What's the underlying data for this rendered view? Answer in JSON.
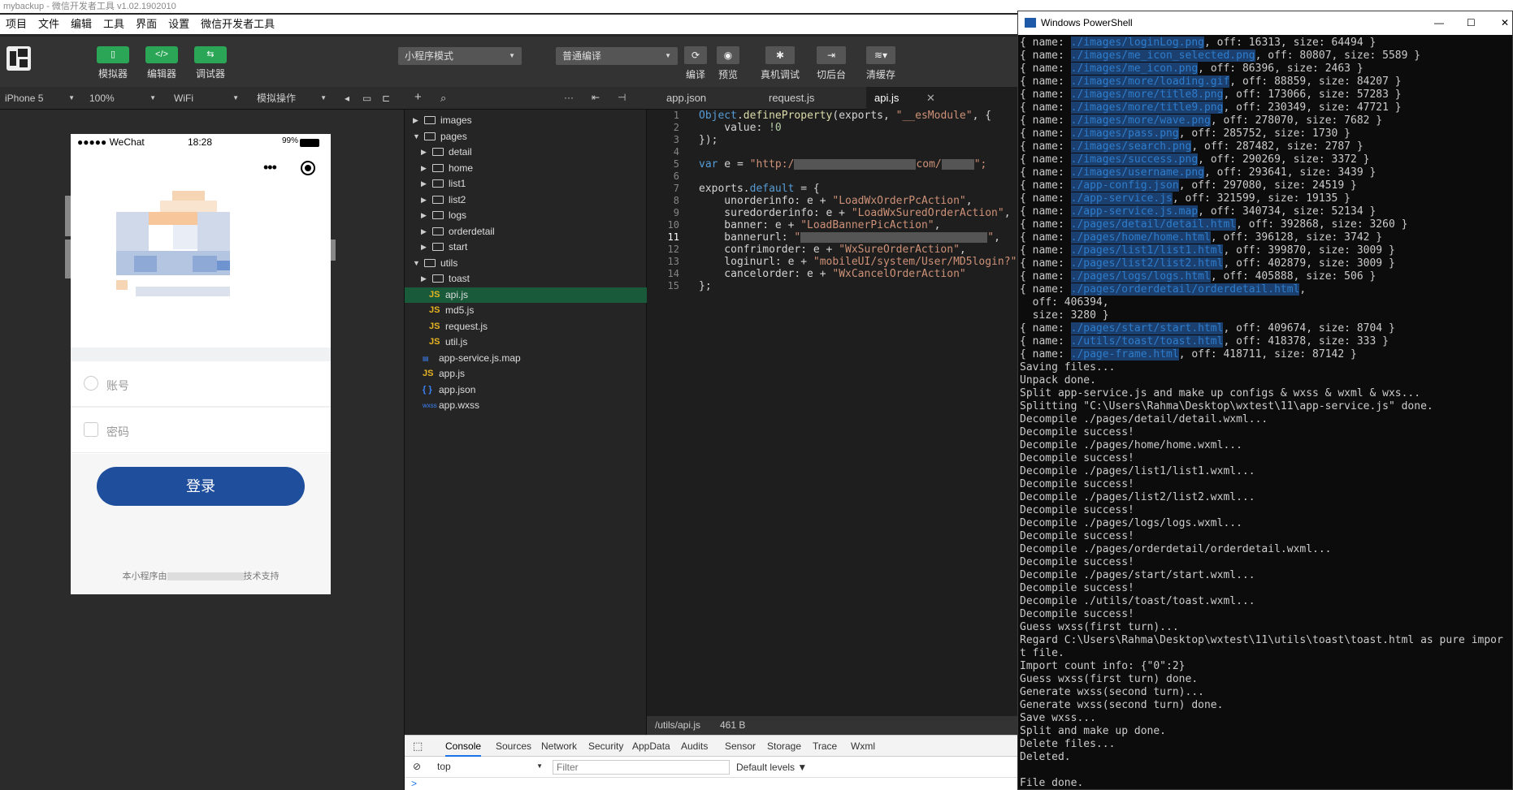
{
  "window": {
    "title": "mybackup - 微信开发者工具 v1.02.1902010"
  },
  "menu": [
    "项目",
    "文件",
    "编辑",
    "工具",
    "界面",
    "设置",
    "微信开发者工具"
  ],
  "toolbar": {
    "simulator": "模拟器",
    "editor": "编辑器",
    "debugger": "调试器",
    "mode": "小程序模式",
    "compile_mode": "普通编译",
    "compile": "编译",
    "preview": "预览",
    "remote_debug": "真机调试",
    "background": "切后台",
    "clear_cache": "清缓存"
  },
  "simulator_bar": {
    "device": "iPhone 5",
    "zoom": "100%",
    "network": "WiFi",
    "operation": "模拟操作"
  },
  "phone": {
    "carrier": "●●●●● WeChat",
    "time": "18:28",
    "battery": "99%",
    "account_placeholder": "账号",
    "password_placeholder": "密码",
    "login_button": "登录",
    "support_prefix": "本小程序由",
    "support_suffix": "技术支持"
  },
  "file_tree": [
    {
      "name": "images",
      "type": "folder",
      "depth": 0,
      "open": false
    },
    {
      "name": "pages",
      "type": "folder",
      "depth": 0,
      "open": true
    },
    {
      "name": "detail",
      "type": "folder",
      "depth": 1,
      "open": false
    },
    {
      "name": "home",
      "type": "folder",
      "depth": 1,
      "open": false
    },
    {
      "name": "list1",
      "type": "folder",
      "depth": 1,
      "open": false
    },
    {
      "name": "list2",
      "type": "folder",
      "depth": 1,
      "open": false
    },
    {
      "name": "logs",
      "type": "folder",
      "depth": 1,
      "open": false
    },
    {
      "name": "orderdetail",
      "type": "folder",
      "depth": 1,
      "open": false
    },
    {
      "name": "start",
      "type": "folder",
      "depth": 1,
      "open": false
    },
    {
      "name": "utils",
      "type": "folder",
      "depth": 0,
      "open": true
    },
    {
      "name": "toast",
      "type": "folder",
      "depth": 1,
      "open": false
    },
    {
      "name": "api.js",
      "type": "js",
      "depth": 1,
      "active": true
    },
    {
      "name": "md5.js",
      "type": "js",
      "depth": 1
    },
    {
      "name": "request.js",
      "type": "js",
      "depth": 1
    },
    {
      "name": "util.js",
      "type": "js",
      "depth": 1
    },
    {
      "name": "app-service.js.map",
      "type": "map",
      "depth": 0
    },
    {
      "name": "app.js",
      "type": "js",
      "depth": 0
    },
    {
      "name": "app.json",
      "type": "json",
      "depth": 0
    },
    {
      "name": "app.wxss",
      "type": "wxss",
      "depth": 0
    }
  ],
  "editor_tabs": [
    {
      "label": "app.json"
    },
    {
      "label": "request.js"
    },
    {
      "label": "api.js",
      "active": true
    }
  ],
  "code": {
    "line_numbers": [
      "1",
      "2",
      "3",
      "4",
      "5",
      "6",
      "7",
      "8",
      "9",
      "10",
      "11",
      "12",
      "13",
      "14",
      "15"
    ],
    "l1_obj": "Object",
    "l1_fn": "defineProperty",
    "l1_args": "(exports, ",
    "l1_str": "\"__esModule\"",
    "l1_end": ", {",
    "l2_key": "    value: ",
    "l2_val": "!0",
    "l3": "});",
    "l5_kw": "var",
    "l5_mid": " e = ",
    "l5_s1": "\"http:/",
    "l5_s2": "com/",
    "l5_s3": "\";",
    "l7_a": "exports.",
    "l7_kw": "default",
    "l7_b": " = {",
    "l8_k": "    unorderinfo: e + ",
    "l8_s": "\"LoadWxOrderPcAction\"",
    "l8_e": ",",
    "l9_k": "    suredorderinfo: e + ",
    "l9_s": "\"LoadWxSuredOrderAction\"",
    "l9_e": ",",
    "l10_k": "    banner: e + ",
    "l10_s": "\"LoadBannerPicAction\"",
    "l10_e": ",",
    "l11_k": "    bannerurl: ",
    "l11_s1": "\"",
    "l11_s2": "\"",
    "l11_e": ",",
    "l12_k": "    confrimorder: e + ",
    "l12_s": "\"WxSureOrderAction\"",
    "l12_e": ",",
    "l13_k": "    loginurl: e + ",
    "l13_s": "\"mobileUI/system/User/MD5login?\"",
    "l13_e": ",",
    "l14_k": "    cancelorder: e + ",
    "l14_s": "\"WxCancelOrderAction\"",
    "l15": "};"
  },
  "editor_status": {
    "path": "/utils/api.js",
    "size": "461 B"
  },
  "devtools": {
    "tabs": [
      "Console",
      "Sources",
      "Network",
      "Security",
      "AppData",
      "Audits",
      "Sensor",
      "Storage",
      "Trace",
      "Wxml"
    ],
    "context": "top",
    "filter_placeholder": "Filter",
    "levels": "Default levels",
    "prompt": ">"
  },
  "powershell": {
    "title": "Windows PowerShell",
    "lines": [
      {
        "pre": "{ name: ",
        "hl": "./images/loginLog.png",
        "post": ", off: 16313, size: 64494 }"
      },
      {
        "pre": "{ name: ",
        "hl": "./images/me_icon_selected.png",
        "post": ", off: 80807, size: 5589 }"
      },
      {
        "pre": "{ name: ",
        "hl": "./images/me_icon.png",
        "post": ", off: 86396, size: 2463 }"
      },
      {
        "pre": "{ name: ",
        "hl": "./images/more/loading.gif",
        "post": ", off: 88859, size: 84207 }"
      },
      {
        "pre": "{ name: ",
        "hl": "./images/more/title8.png",
        "post": ", off: 173066, size: 57283 }"
      },
      {
        "pre": "{ name: ",
        "hl": "./images/more/title9.png",
        "post": ", off: 230349, size: 47721 }"
      },
      {
        "pre": "{ name: ",
        "hl": "./images/more/wave.png",
        "post": ", off: 278070, size: 7682 }"
      },
      {
        "pre": "{ name: ",
        "hl": "./images/pass.png",
        "post": ", off: 285752, size: 1730 }"
      },
      {
        "pre": "{ name: ",
        "hl": "./images/search.png",
        "post": ", off: 287482, size: 2787 }"
      },
      {
        "pre": "{ name: ",
        "hl": "./images/success.png",
        "post": ", off: 290269, size: 3372 }"
      },
      {
        "pre": "{ name: ",
        "hl": "./images/username.png",
        "post": ", off: 293641, size: 3439 }"
      },
      {
        "pre": "{ name: ",
        "hl": "./app-config.json",
        "post": ", off: 297080, size: 24519 }"
      },
      {
        "pre": "{ name: ",
        "hl": "./app-service.js",
        "post": ", off: 321599, size: 19135 }"
      },
      {
        "pre": "{ name: ",
        "hl": "./app-service.js.map",
        "post": ", off: 340734, size: 52134 }"
      },
      {
        "pre": "{ name: ",
        "hl": "./pages/detail/detail.html",
        "post": ", off: 392868, size: 3260 }"
      },
      {
        "pre": "{ name: ",
        "hl": "./pages/home/home.html",
        "post": ", off: 396128, size: 3742 }"
      },
      {
        "pre": "{ name: ",
        "hl": "./pages/list1/list1.html",
        "post": ", off: 399870, size: 3009 }"
      },
      {
        "pre": "{ name: ",
        "hl": "./pages/list2/list2.html",
        "post": ", off: 402879, size: 3009 }"
      },
      {
        "pre": "{ name: ",
        "hl": "./pages/logs/logs.html",
        "post": ", off: 405888, size: 506 }"
      },
      {
        "pre": "{ name: ",
        "hl": "./pages/orderdetail/orderdetail.html",
        "post": ","
      },
      {
        "pre": "  off: 406394,",
        "hl": "",
        "post": ""
      },
      {
        "pre": "  size: 3280 }",
        "hl": "",
        "post": ""
      },
      {
        "pre": "{ name: ",
        "hl": "./pages/start/start.html",
        "post": ", off: 409674, size: 8704 }"
      },
      {
        "pre": "{ name: ",
        "hl": "./utils/toast/toast.html",
        "post": ", off: 418378, size: 333 }"
      },
      {
        "pre": "{ name: ",
        "hl": "./page-frame.html",
        "post": ", off: 418711, size: 87142 }"
      },
      {
        "pre": "Saving files...",
        "hl": "",
        "post": ""
      },
      {
        "pre": "Unpack done.",
        "hl": "",
        "post": ""
      },
      {
        "pre": "Split app-service.js and make up configs & wxss & wxml & wxs...",
        "hl": "",
        "post": ""
      },
      {
        "pre": "Splitting \"C:\\Users\\Rahma\\Desktop\\wxtest\\11\\app-service.js\" done.",
        "hl": "",
        "post": ""
      },
      {
        "pre": "Decompile ./pages/detail/detail.wxml...",
        "hl": "",
        "post": ""
      },
      {
        "pre": "Decompile success!",
        "hl": "",
        "post": ""
      },
      {
        "pre": "Decompile ./pages/home/home.wxml...",
        "hl": "",
        "post": ""
      },
      {
        "pre": "Decompile success!",
        "hl": "",
        "post": ""
      },
      {
        "pre": "Decompile ./pages/list1/list1.wxml...",
        "hl": "",
        "post": ""
      },
      {
        "pre": "Decompile success!",
        "hl": "",
        "post": ""
      },
      {
        "pre": "Decompile ./pages/list2/list2.wxml...",
        "hl": "",
        "post": ""
      },
      {
        "pre": "Decompile success!",
        "hl": "",
        "post": ""
      },
      {
        "pre": "Decompile ./pages/logs/logs.wxml...",
        "hl": "",
        "post": ""
      },
      {
        "pre": "Decompile success!",
        "hl": "",
        "post": ""
      },
      {
        "pre": "Decompile ./pages/orderdetail/orderdetail.wxml...",
        "hl": "",
        "post": ""
      },
      {
        "pre": "Decompile success!",
        "hl": "",
        "post": ""
      },
      {
        "pre": "Decompile ./pages/start/start.wxml...",
        "hl": "",
        "post": ""
      },
      {
        "pre": "Decompile success!",
        "hl": "",
        "post": ""
      },
      {
        "pre": "Decompile ./utils/toast/toast.wxml...",
        "hl": "",
        "post": ""
      },
      {
        "pre": "Decompile success!",
        "hl": "",
        "post": ""
      },
      {
        "pre": "Guess wxss(first turn)...",
        "hl": "",
        "post": ""
      },
      {
        "pre": "Regard C:\\Users\\Rahma\\Desktop\\wxtest\\11\\utils\\toast\\toast.html as pure impor",
        "hl": "",
        "post": ""
      },
      {
        "pre": "t file.",
        "hl": "",
        "post": ""
      },
      {
        "pre": "Import count info: {\"0\":2}",
        "hl": "",
        "post": ""
      },
      {
        "pre": "Guess wxss(first turn) done.",
        "hl": "",
        "post": ""
      },
      {
        "pre": "Generate wxss(second turn)...",
        "hl": "",
        "post": ""
      },
      {
        "pre": "Generate wxss(second turn) done.",
        "hl": "",
        "post": ""
      },
      {
        "pre": "Save wxss...",
        "hl": "",
        "post": ""
      },
      {
        "pre": "Split and make up done.",
        "hl": "",
        "post": ""
      },
      {
        "pre": "Delete files...",
        "hl": "",
        "post": ""
      },
      {
        "pre": "Deleted.",
        "hl": "",
        "post": ""
      },
      {
        "pre": "",
        "hl": "",
        "post": ""
      },
      {
        "pre": "File done.",
        "hl": "",
        "post": ""
      }
    ]
  },
  "colors": {
    "accent_green": "#2aa656",
    "login_blue": "#1f4e9d",
    "active_file_bg": "#185a3a",
    "path_highlight": "#2e7dcc"
  }
}
